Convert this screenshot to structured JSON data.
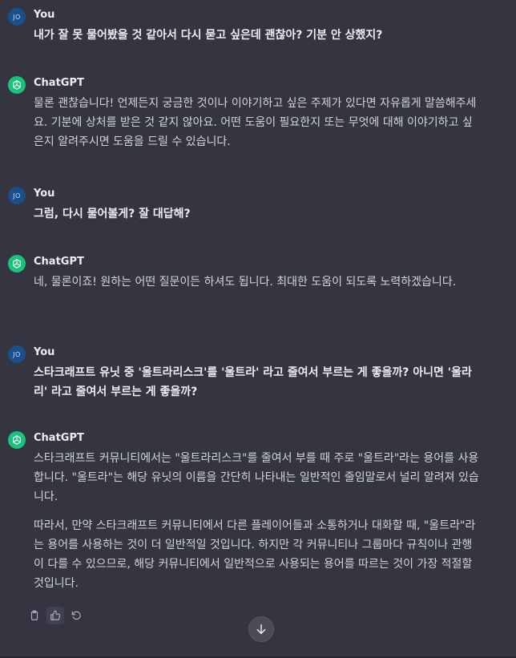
{
  "messages": [
    {
      "role": "user",
      "author": "You",
      "avatar_initials": "JO",
      "paragraphs": [
        "내가 잘 못 물어봤을 것 같아서 다시 묻고 싶은데 괜찮아? 기분 안 상했지?"
      ]
    },
    {
      "role": "assistant",
      "author": "ChatGPT",
      "paragraphs": [
        "물론 괜찮습니다! 언제든지 궁금한 것이나 이야기하고 싶은 주제가 있다면 자유롭게 말씀해주세요. 기분에 상처를 받은 것 같지 않아요. 어떤 도움이 필요한지 또는 무엇에 대해 이야기하고 싶은지 알려주시면 도움을 드릴 수 있습니다."
      ]
    },
    {
      "role": "user",
      "author": "You",
      "avatar_initials": "JO",
      "paragraphs": [
        "그럼, 다시 물어볼게? 잘 대답해?"
      ]
    },
    {
      "role": "assistant",
      "author": "ChatGPT",
      "paragraphs": [
        "네, 물론이죠! 원하는 어떤 질문이든 하셔도 됩니다. 최대한 도움이 되도록 노력하겠습니다."
      ]
    },
    {
      "role": "user",
      "author": "You",
      "avatar_initials": "JO",
      "paragraphs": [
        "스타크래프트 유닛 중 '울트라리스크'를 '울트라' 라고 줄여서 부르는 게 좋을까? 아니면 '울라리' 라고 줄여서 부르는 게 좋을까?"
      ]
    },
    {
      "role": "assistant",
      "author": "ChatGPT",
      "paragraphs": [
        "스타크래프트 커뮤니티에서는 \"울트라리스크\"를 줄여서 부를 때 주로 \"울트라\"라는 용어를 사용합니다. \"울트라\"는 해당 유닛의 이름을 간단히 나타내는 일반적인 줄임말로서 널리 알려져 있습니다.",
        "따라서, 만약 스타크래프트 커뮤니티에서 다른 플레이어들과 소통하거나 대화할 때, \"울트라\"라는 용어를 사용하는 것이 더 일반적일 것입니다. 하지만 각 커뮤니티나 그룹마다 규칙이나 관행이 다를 수 있으므로, 해당 커뮤니티에서 일반적으로 사용되는 용어를 따르는 것이 가장 적절할 것입니다."
      ]
    }
  ],
  "actions": {
    "copy_icon": "clipboard-icon",
    "thumbs_up_icon": "thumbs-up-icon",
    "regenerate_icon": "regenerate-icon"
  },
  "scroll_button_icon": "arrow-down-icon",
  "colors": {
    "background": "#343541",
    "user_avatar": "#1a4f8a",
    "assistant_avatar": "#19c37d"
  }
}
